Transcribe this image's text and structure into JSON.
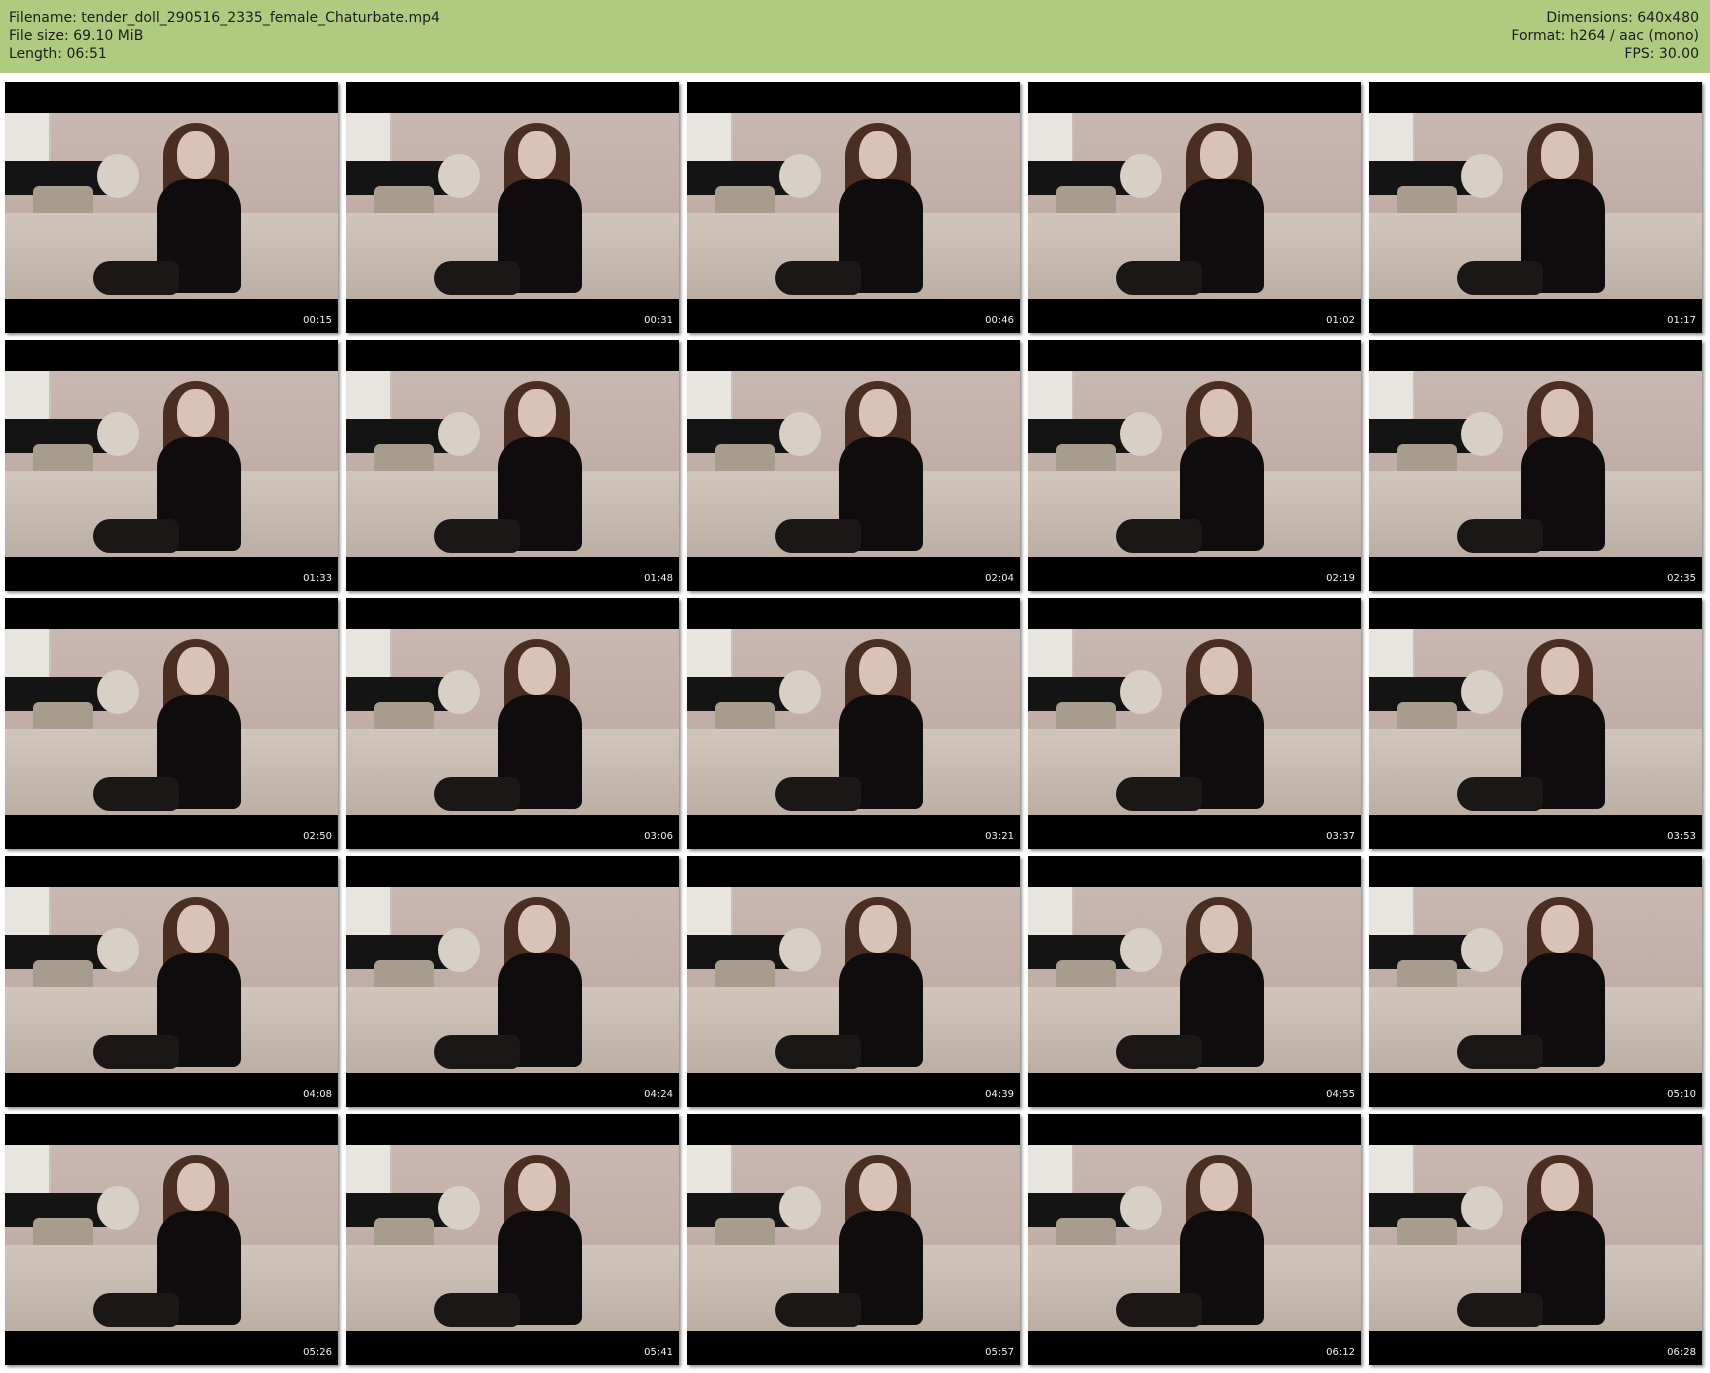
{
  "header": {
    "filename": "Filename: tender_doll_290516_2335_female_Chaturbate.mp4",
    "file_size": "File size: 69.10 MiB",
    "length": "Length: 06:51",
    "dimensions": "Dimensions: 640x480",
    "format": "Format: h264 / aac (mono)",
    "fps": "FPS: 30.00"
  },
  "thumbnails": [
    {
      "timestamp": "00:15"
    },
    {
      "timestamp": "00:31"
    },
    {
      "timestamp": "00:46"
    },
    {
      "timestamp": "01:02"
    },
    {
      "timestamp": "01:17"
    },
    {
      "timestamp": "01:33"
    },
    {
      "timestamp": "01:48"
    },
    {
      "timestamp": "02:04"
    },
    {
      "timestamp": "02:19"
    },
    {
      "timestamp": "02:35"
    },
    {
      "timestamp": "02:50"
    },
    {
      "timestamp": "03:06"
    },
    {
      "timestamp": "03:21"
    },
    {
      "timestamp": "03:37"
    },
    {
      "timestamp": "03:53"
    },
    {
      "timestamp": "04:08"
    },
    {
      "timestamp": "04:24"
    },
    {
      "timestamp": "04:39"
    },
    {
      "timestamp": "04:55"
    },
    {
      "timestamp": "05:10"
    },
    {
      "timestamp": "05:26"
    },
    {
      "timestamp": "05:41"
    },
    {
      "timestamp": "05:57"
    },
    {
      "timestamp": "06:12"
    },
    {
      "timestamp": "06:28"
    }
  ],
  "colors": {
    "header_background": "#aecb80",
    "page_background": "#ffffff",
    "thumbnail_border": "#000000"
  }
}
